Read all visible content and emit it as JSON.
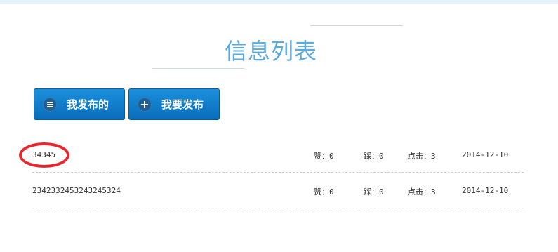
{
  "page": {
    "title": "信息列表"
  },
  "buttons": {
    "my_posts": {
      "label": "我发布的",
      "icon": "menu-icon"
    },
    "post_new": {
      "label": "我要发布",
      "icon": "plus-icon"
    }
  },
  "list": {
    "items": [
      {
        "name": "34345",
        "likes": "赞：0",
        "dislikes": "踩：0",
        "clicks": "点击：3",
        "date": "2014-12-10"
      },
      {
        "name": "2342332453243245324",
        "likes": "赞：0",
        "dislikes": "踩：0",
        "clicks": "点击：3",
        "date": "2014-12-10"
      }
    ]
  },
  "colors": {
    "accent": "#5aa9df",
    "button": "#0a7bcb",
    "annotation": "#e8262c"
  }
}
